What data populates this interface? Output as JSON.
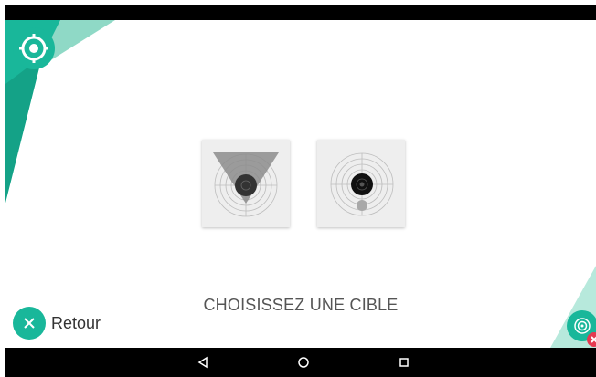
{
  "instruction": "CHOISISSEZ UNE CIBLE",
  "back_button": {
    "label": "Retour",
    "icon": "close-icon"
  },
  "targets": [
    {
      "name": "target-with-triangle-visor",
      "icon": "target-triangle-icon"
    },
    {
      "name": "target-with-small-ball",
      "icon": "target-ball-icon"
    }
  ],
  "nav_bar": {
    "buttons": [
      "back-triangle-icon",
      "home-circle-icon",
      "recents-square-icon"
    ]
  },
  "colors": {
    "accent": "#19b79a",
    "accent_light": "#8fd9c6",
    "badge": "#e53950",
    "card": "#eeeeee",
    "text": "#555555"
  }
}
